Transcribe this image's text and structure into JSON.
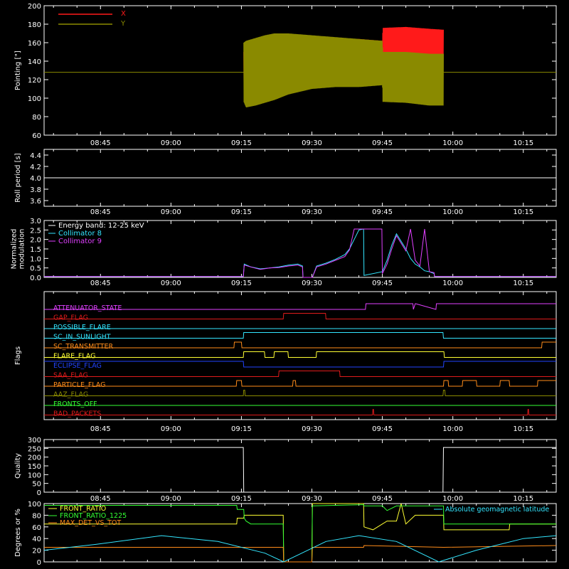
{
  "colors": {
    "background": "#000000",
    "frame": "#ffffff",
    "x_red": "#ff1a1a",
    "y_olive": "#8a8a00",
    "cyan": "#33e6ff",
    "magenta": "#e040ff",
    "orange": "#ff8c1a",
    "green": "#33ff33",
    "yellow": "#ffff33",
    "red": "#e01b1b",
    "blue": "#2244ff",
    "white": "#ffffff"
  },
  "time_ticks": [
    "08:45",
    "09:00",
    "09:15",
    "09:30",
    "09:45",
    "10:00",
    "10:15"
  ],
  "time_tick_minutes": [
    525,
    540,
    555,
    570,
    585,
    600,
    615
  ],
  "time_range_minutes": [
    513,
    622
  ],
  "chart_data": [
    {
      "type": "line",
      "panel": "pointing",
      "ylabel": "Pointing [\"]",
      "ylim": [
        60,
        200
      ],
      "yticks": [
        60,
        80,
        100,
        120,
        140,
        160,
        180,
        200
      ],
      "legend": [
        {
          "label": "X",
          "color": "#ff1a1a"
        },
        {
          "label": "Y",
          "color": "#8a8a00"
        }
      ],
      "reference_level": 128,
      "series": [
        {
          "name": "X",
          "x_minutes": [
            555.5,
            556,
            558,
            560,
            562,
            565,
            570,
            575,
            580,
            585,
            585.1,
            590,
            595,
            598
          ],
          "upper": [
            150,
            155,
            160,
            162,
            164,
            166,
            166,
            165,
            164,
            162,
            176,
            177,
            175,
            174
          ],
          "lower": [
            118,
            105,
            110,
            115,
            118,
            122,
            124,
            124,
            124,
            124,
            140,
            140,
            140,
            142
          ]
        },
        {
          "name": "Y",
          "x_minutes": [
            555.5,
            556,
            558,
            560,
            562,
            565,
            570,
            575,
            580,
            585,
            585.1,
            590,
            595,
            598
          ],
          "upper": [
            160,
            162,
            165,
            168,
            170,
            170,
            168,
            166,
            164,
            162,
            150,
            150,
            148,
            148
          ],
          "lower": [
            96,
            90,
            92,
            95,
            98,
            104,
            110,
            112,
            112,
            114,
            96,
            95,
            92,
            92
          ]
        }
      ]
    },
    {
      "type": "line",
      "panel": "roll",
      "ylabel": "Roll period [s]",
      "ylim": [
        3.5,
        4.5
      ],
      "yticks": [
        3.6,
        3.8,
        4.0,
        4.2,
        4.4
      ],
      "series": [
        {
          "x_minutes": [
            513,
            622
          ],
          "y": [
            4.0,
            4.0
          ]
        }
      ]
    },
    {
      "type": "line",
      "panel": "modulation",
      "ylabel_lines": [
        "Normalized",
        "modulation"
      ],
      "ylim": [
        0,
        3.0
      ],
      "yticks": [
        0.0,
        0.5,
        1.0,
        1.5,
        2.0,
        2.5,
        3.0
      ],
      "legend": [
        {
          "label": "Energy band: 12-25 keV",
          "color": "#ffffff"
        },
        {
          "label": "Collimator 8",
          "color": "#33e6ff"
        },
        {
          "label": "Collimator 9",
          "color": "#e040ff"
        }
      ],
      "series": [
        {
          "name": "Collimator 8",
          "x_minutes": [
            513,
            555.4,
            555.6,
            557,
            559,
            561,
            563,
            565,
            567,
            568,
            568.1,
            570,
            570.1,
            571,
            573,
            575,
            577,
            578,
            579,
            580,
            581,
            581.1,
            585,
            586,
            587,
            588,
            589,
            590,
            591,
            592,
            593,
            594,
            595,
            596,
            596.1,
            622
          ],
          "y": [
            0.05,
            0.05,
            0.7,
            0.55,
            0.45,
            0.5,
            0.55,
            0.65,
            0.7,
            0.6,
            0.0,
            0.0,
            0.0,
            0.6,
            0.75,
            0.95,
            1.2,
            1.5,
            2.0,
            2.5,
            2.55,
            0.1,
            0.3,
            0.9,
            1.7,
            2.3,
            1.9,
            1.5,
            1.0,
            0.7,
            0.55,
            0.35,
            0.3,
            0.2,
            0.05,
            0.05
          ]
        },
        {
          "name": "Collimator 9",
          "x_minutes": [
            513,
            555.4,
            555.6,
            557,
            559,
            561,
            563,
            565,
            567,
            568,
            568.1,
            570,
            570.1,
            571,
            573,
            575,
            577,
            578,
            579,
            580,
            581,
            581.1,
            584.9,
            585,
            586,
            587,
            588,
            589,
            590,
            591,
            592,
            593,
            594,
            595,
            596,
            596.1,
            622
          ],
          "y": [
            0.05,
            0.05,
            0.65,
            0.55,
            0.42,
            0.5,
            0.52,
            0.6,
            0.65,
            0.55,
            0.0,
            0.0,
            0.0,
            0.55,
            0.7,
            0.9,
            1.1,
            1.45,
            2.55,
            2.55,
            2.55,
            2.55,
            2.55,
            0.2,
            0.7,
            1.5,
            2.2,
            1.8,
            1.4,
            2.55,
            0.9,
            0.6,
            2.55,
            0.3,
            0.25,
            0.05,
            0.05
          ]
        }
      ]
    },
    {
      "type": "line",
      "panel": "flags",
      "ylabel": "Flags",
      "lanes": [
        {
          "label": "ATTENUATOR_STATE",
          "color": "#e040ff",
          "x_minutes": [
            513,
            581.4,
            581.5,
            591.5,
            591.6,
            592,
            592.1,
            596.4,
            596.5,
            622
          ],
          "state": [
            0,
            0,
            1,
            1,
            0,
            1,
            1,
            0,
            1,
            1
          ]
        },
        {
          "label": "GAP_FLAG",
          "color": "#e01b1b",
          "x_minutes": [
            513,
            563.9,
            564,
            572.9,
            573,
            622
          ],
          "state": [
            0,
            0,
            1,
            1,
            0,
            0
          ]
        },
        {
          "label": "POSSIBLE_FLARE",
          "color": "#33e6ff",
          "x_minutes": [
            513,
            622
          ],
          "state": [
            0,
            0
          ]
        },
        {
          "label": "SC_IN_SUNLIGHT",
          "color": "#33e6ff",
          "x_minutes": [
            513,
            555.4,
            555.5,
            597.9,
            598,
            622
          ],
          "state": [
            0,
            0,
            1,
            1,
            0,
            0
          ]
        },
        {
          "label": "SC_TRANSMITTER",
          "color": "#ff8c1a",
          "x_minutes": [
            513,
            553.4,
            553.5,
            555,
            555.1,
            598,
            598.1,
            618.9,
            619,
            622
          ],
          "state": [
            0,
            0,
            1,
            1,
            0,
            0,
            0,
            0,
            1,
            1
          ]
        },
        {
          "label": "FLARE_FLAG",
          "color": "#ffff33",
          "x_minutes": [
            513,
            555.4,
            555.5,
            559.9,
            560,
            561.9,
            562,
            564.9,
            565,
            570.9,
            571,
            598.1,
            598.2,
            622
          ],
          "state": [
            0,
            0,
            1,
            1,
            0,
            0,
            1,
            1,
            0,
            0,
            1,
            1,
            0,
            0
          ]
        },
        {
          "label": "ECLIPSE_FLAG",
          "color": "#2244ff",
          "x_minutes": [
            513,
            555.4,
            555.5,
            598,
            598.1,
            622
          ],
          "state": [
            1,
            1,
            0,
            0,
            1,
            1
          ]
        },
        {
          "label": "SAA_FLAG",
          "color": "#e01b1b",
          "x_minutes": [
            513,
            562.9,
            563,
            575.9,
            576,
            622
          ],
          "state": [
            0,
            0,
            1,
            1,
            0,
            0
          ]
        },
        {
          "label": "PARTICLE_FLAG",
          "color": "#ff8c1a",
          "x_minutes": [
            513,
            553.9,
            554,
            555,
            555.1,
            565.9,
            566,
            566.5,
            566.6,
            598,
            598.1,
            599,
            599.1,
            602,
            602.1,
            605,
            605.1,
            610,
            610.1,
            612,
            612.1,
            618,
            618.1,
            622
          ],
          "state": [
            0,
            0,
            1,
            1,
            0,
            0,
            1,
            1,
            0,
            0,
            1,
            1,
            0,
            0,
            1,
            1,
            0,
            0,
            1,
            1,
            0,
            0,
            1,
            1
          ]
        },
        {
          "label": "AAZ_FLAG",
          "color": "#8a8a00",
          "x_minutes": [
            513,
            555.4,
            555.5,
            555.7,
            555.8,
            597.9,
            598,
            598.3,
            598.4,
            622
          ],
          "state": [
            0,
            0,
            1,
            1,
            0,
            0,
            1,
            1,
            0,
            0
          ]
        },
        {
          "label": "FRONTS_OFF",
          "color": "#33ff33",
          "x_minutes": [
            513,
            622
          ],
          "state": [
            0,
            0
          ]
        },
        {
          "label": "BAD_PACKETS",
          "color": "#e01b1b",
          "x_minutes": [
            513,
            582.9,
            583,
            583.1,
            583.2,
            615.9,
            616,
            616.1,
            616.2,
            622
          ],
          "state": [
            0,
            0,
            1,
            1,
            0,
            0,
            1,
            1,
            0,
            0
          ]
        }
      ]
    },
    {
      "type": "line",
      "panel": "quality",
      "ylabel": "Quality",
      "ylim": [
        0,
        300
      ],
      "yticks": [
        0,
        50,
        100,
        150,
        200,
        250,
        300
      ],
      "series": [
        {
          "x_minutes": [
            513,
            555.4,
            555.5,
            597.9,
            598,
            622
          ],
          "y": [
            255,
            255,
            0,
            0,
            255,
            255
          ]
        }
      ]
    },
    {
      "type": "line",
      "panel": "ratios",
      "ylabel": "Degrees or %",
      "ylim": [
        0,
        100
      ],
      "yticks": [
        0,
        20,
        40,
        60,
        80,
        100
      ],
      "legend": [
        {
          "label": "FRONT_RATIO",
          "color": "#ffff33"
        },
        {
          "label": "FRONT_RATIO_1225",
          "color": "#33ff33"
        },
        {
          "label": "MAX_DET_VS_TOT",
          "color": "#ff8c1a"
        },
        {
          "label": "Absolute geomagnetic latitude",
          "color": "#33e6ff"
        }
      ],
      "series": [
        {
          "name": "FRONT_RATIO",
          "x_minutes": [
            513,
            554,
            554.1,
            555.5,
            555.6,
            563.9,
            564,
            570,
            570.1,
            580,
            581,
            581.1,
            583,
            584,
            586,
            588,
            589,
            590,
            592,
            593,
            597,
            598,
            598.1,
            612,
            612.1,
            622
          ],
          "y": [
            65,
            65,
            75,
            75,
            80,
            80,
            0,
            0,
            100,
            100,
            100,
            60,
            55,
            60,
            70,
            70,
            100,
            65,
            80,
            80,
            80,
            80,
            55,
            55,
            65,
            65
          ]
        },
        {
          "name": "FRONT_RATIO_1225",
          "x_minutes": [
            513,
            554,
            554.1,
            555.5,
            555.6,
            556,
            557,
            563.9,
            564,
            570,
            570.1,
            581,
            581.1,
            583,
            585,
            586,
            588,
            590,
            597,
            598,
            598.1,
            612,
            612.1,
            622
          ],
          "y": [
            97,
            97,
            90,
            90,
            75,
            70,
            65,
            65,
            0,
            0,
            96,
            98,
            96,
            96,
            96,
            88,
            96,
            96,
            96,
            96,
            65,
            65,
            65,
            65
          ]
        },
        {
          "name": "MAX_DET_VS_TOT",
          "x_minutes": [
            513,
            563.9,
            564,
            570,
            570.1,
            581,
            581.1,
            598,
            598.1,
            622
          ],
          "y": [
            25,
            25,
            0,
            0,
            25,
            25,
            28,
            25,
            25,
            28
          ]
        },
        {
          "name": "Absolute geomagnetic latitude",
          "x_minutes": [
            513,
            524,
            538,
            550,
            560,
            564,
            573,
            580,
            588,
            597,
            605,
            615,
            622
          ],
          "y": [
            20,
            30,
            45,
            35,
            15,
            0,
            35,
            45,
            35,
            0,
            20,
            40,
            45
          ]
        }
      ]
    }
  ]
}
